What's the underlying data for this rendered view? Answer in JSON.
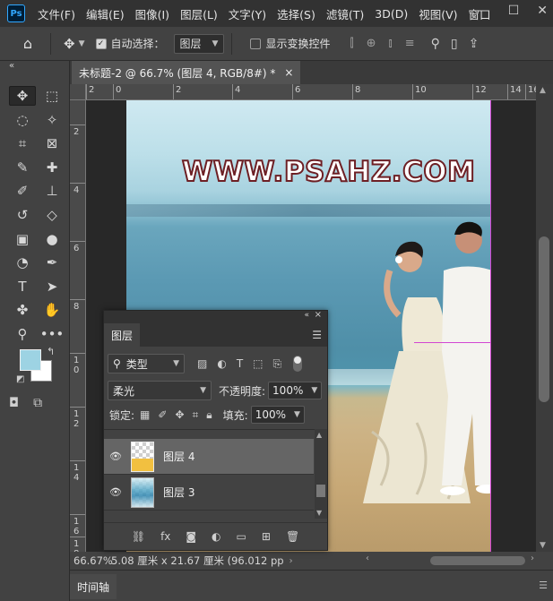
{
  "menubar": {
    "logo": "Ps",
    "items": [
      "文件(F)",
      "编辑(E)",
      "图像(I)",
      "图层(L)",
      "文字(Y)",
      "选择(S)",
      "滤镜(T)",
      "3D(D)",
      "视图(V)",
      "窗口"
    ],
    "window_buttons": [
      "—",
      "☐",
      "✕"
    ]
  },
  "options": {
    "auto_select_label": "自动选择：",
    "auto_select_checked": true,
    "auto_select_target": "图层",
    "show_transform_label": "显示变换控件",
    "show_transform_checked": false
  },
  "toolbar": {
    "collapse": "«",
    "tools": [
      {
        "name": "move-tool",
        "glyph": "✥",
        "active": true
      },
      {
        "name": "marquee-tool",
        "glyph": "⬚"
      },
      {
        "name": "lasso-tool",
        "glyph": "◌"
      },
      {
        "name": "magic-wand-tool",
        "glyph": "✧"
      },
      {
        "name": "crop-tool",
        "glyph": "⌗"
      },
      {
        "name": "frame-tool",
        "glyph": "⊠"
      },
      {
        "name": "eyedropper-tool",
        "glyph": "✎"
      },
      {
        "name": "healing-brush-tool",
        "glyph": "✚"
      },
      {
        "name": "brush-tool",
        "glyph": "✐"
      },
      {
        "name": "clone-stamp-tool",
        "glyph": "⊥"
      },
      {
        "name": "history-brush-tool",
        "glyph": "↺"
      },
      {
        "name": "eraser-tool",
        "glyph": "◇"
      },
      {
        "name": "gradient-tool",
        "glyph": "▣"
      },
      {
        "name": "blur-tool",
        "glyph": "●"
      },
      {
        "name": "dodge-tool",
        "glyph": "◔"
      },
      {
        "name": "pen-tool",
        "glyph": "✒"
      },
      {
        "name": "type-tool",
        "glyph": "T"
      },
      {
        "name": "path-selection-tool",
        "glyph": "➤"
      },
      {
        "name": "shape-tool",
        "glyph": "✤"
      },
      {
        "name": "hand-tool",
        "glyph": "✋"
      },
      {
        "name": "zoom-tool",
        "glyph": "⚲"
      },
      {
        "name": "more-tools",
        "glyph": "•••"
      }
    ],
    "foreground_color": "#9dd3e3",
    "background_color": "#ffffff"
  },
  "document": {
    "tab_title": "未标题-2 @ 66.7% (图层 4, RGB/8#) *",
    "close": "×",
    "ruler_h": [
      "2",
      "0",
      "2",
      "4",
      "6",
      "8",
      "10",
      "12",
      "14",
      "16"
    ],
    "ruler_v": [
      "2",
      "4",
      "6",
      "8",
      "1\n0",
      "1\n2",
      "1\n4",
      "1\n6",
      "1\n8"
    ],
    "watermark": "WWW.PSAHZ.COM"
  },
  "status": {
    "zoom": "66.67%",
    "info": "5.08 厘米 x 21.67 厘米 (96.012 pp"
  },
  "timeline": {
    "label": "时间轴"
  },
  "layers_panel": {
    "tab": "图层",
    "filter_kind": "类型",
    "blend_mode": "柔光",
    "opacity_label": "不透明度:",
    "opacity_value": "100%",
    "lock_label": "锁定:",
    "fill_label": "填充:",
    "fill_value": "100%",
    "layers": [
      {
        "name": "图层 4",
        "selected": true,
        "visible": true
      },
      {
        "name": "图层 3",
        "selected": false,
        "visible": true
      }
    ]
  }
}
